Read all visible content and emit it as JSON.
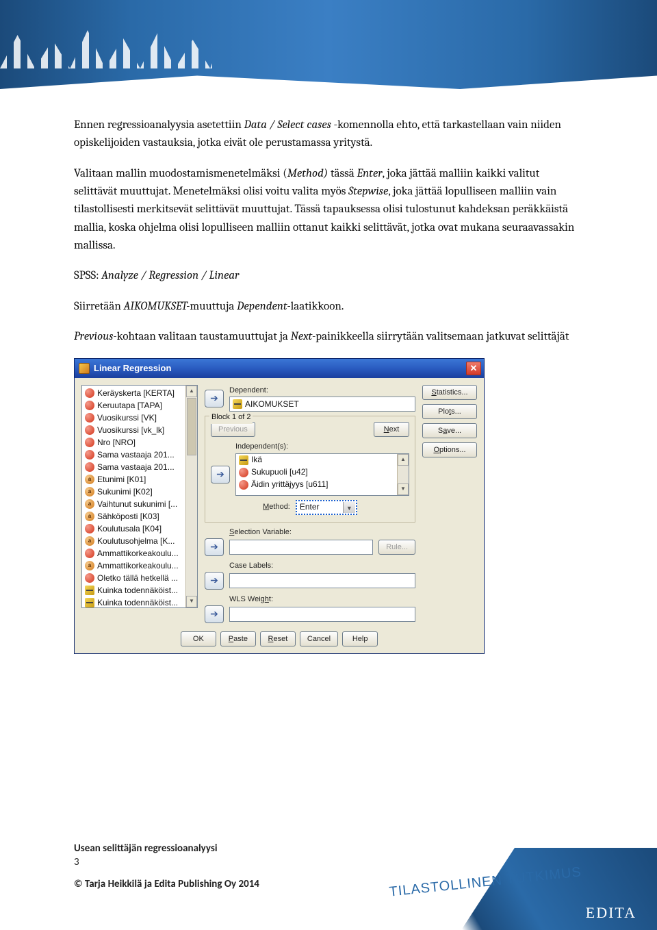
{
  "paragraphs": {
    "p1_a": "Ennen regressioanalyysia asetettiin ",
    "p1_em1": "Data / Select cases",
    "p1_b": " -komennolla ehto, että tarkastellaan vain niiden opiskelijoiden vastauksia, jotka eivät ole perustamassa yritystä.",
    "p2_a": "Valitaan mallin muodostamismenetelmäksi (",
    "p2_em1": "Method) ",
    "p2_b": "tässä ",
    "p2_em2": "Enter",
    "p2_c": ", joka jättää malliin kaikki valitut selittävät muuttujat. Menetelmäksi olisi voitu valita myös ",
    "p2_em3": "Stepwise",
    "p2_d": ", joka jättää lopulliseen malliin vain tilastollisesti merkitsevät selittävät muuttujat. Tässä tapauksessa olisi tulostunut kahdeksan peräkkäistä mallia, koska ohjelma olisi lopulliseen malliin ottanut kaikki selittävät, jotka ovat mukana seuraavassakin mallissa.",
    "p3_a": "SPSS:  ",
    "p3_em1": "Analyze / Regression / Linear",
    "p4_a": "Siirretään ",
    "p4_em1": "AIKOMUKSET-",
    "p4_b": "muuttuja ",
    "p4_em2": "Dependent-",
    "p4_c": "laatikkoon.",
    "p5_em1": "Previous-",
    "p5_a": "kohtaan valitaan taustamuuttujat ja ",
    "p5_em2": "Next-",
    "p5_b": "painikkeella siirrytään valitsemaan jatkuvat selittäjät"
  },
  "dialog": {
    "title": "Linear Regression",
    "var_list": [
      {
        "type": "nominal",
        "label": "Keräyskerta [KERTA]"
      },
      {
        "type": "nominal",
        "label": "Keruutapa [TAPA]"
      },
      {
        "type": "nominal",
        "label": "Vuosikurssi [VK]"
      },
      {
        "type": "nominal",
        "label": "Vuosikurssi [vk_lk]"
      },
      {
        "type": "nominal",
        "label": "Nro [NRO]"
      },
      {
        "type": "nominal",
        "label": "Sama vastaaja 201..."
      },
      {
        "type": "nominal",
        "label": "Sama vastaaja 201..."
      },
      {
        "type": "string",
        "label": "Etunimi [K01]"
      },
      {
        "type": "string",
        "label": "Sukunimi [K02]"
      },
      {
        "type": "string",
        "label": "Vaihtunut sukunimi [..."
      },
      {
        "type": "string",
        "label": "Sähköposti [K03]"
      },
      {
        "type": "nominal",
        "label": "Koulutusala [K04]"
      },
      {
        "type": "string",
        "label": "Koulutusohjelma [K..."
      },
      {
        "type": "nominal",
        "label": "Ammattikorkeakoulu..."
      },
      {
        "type": "string",
        "label": "Ammattikorkeakoulu..."
      },
      {
        "type": "nominal",
        "label": "Oletko tällä hetkellä ..."
      },
      {
        "type": "scale",
        "label": "Kuinka todennäköist..."
      },
      {
        "type": "scale",
        "label": "Kuinka todennäköist..."
      }
    ],
    "dependent_label": "Dependent:",
    "dependent_value": "AIKOMUKSET",
    "block_label": "Block 1 of 2",
    "previous": "Previous",
    "next": "Next",
    "independent_label": "Independent(s):",
    "independents": [
      {
        "type": "scale",
        "label": "Ikä"
      },
      {
        "type": "nominal",
        "label": "Sukupuoli [u42]"
      },
      {
        "type": "nominal",
        "label": "Äidin yrittäjyys [u611]"
      }
    ],
    "method_label": "Method:",
    "method_value": "Enter",
    "selection_label": "Selection Variable:",
    "rule": "Rule...",
    "case_labels": "Case Labels:",
    "wls": "WLS Weight:",
    "right_buttons": {
      "statistics": "Statistics...",
      "plots": "Plots...",
      "save": "Save...",
      "options": "Options..."
    },
    "bottom_buttons": {
      "ok": "OK",
      "paste": "Paste",
      "reset": "Reset",
      "cancel": "Cancel",
      "help": "Help"
    }
  },
  "footer": {
    "title": "Usean selittäjän regressioanalyysi",
    "page": "3",
    "copyright": "© Tarja Heikkilä ja Edita Publishing Oy 2014",
    "tilasto": "TILASTOLLINEN TUTKIMUS",
    "edita": "EDITA"
  }
}
